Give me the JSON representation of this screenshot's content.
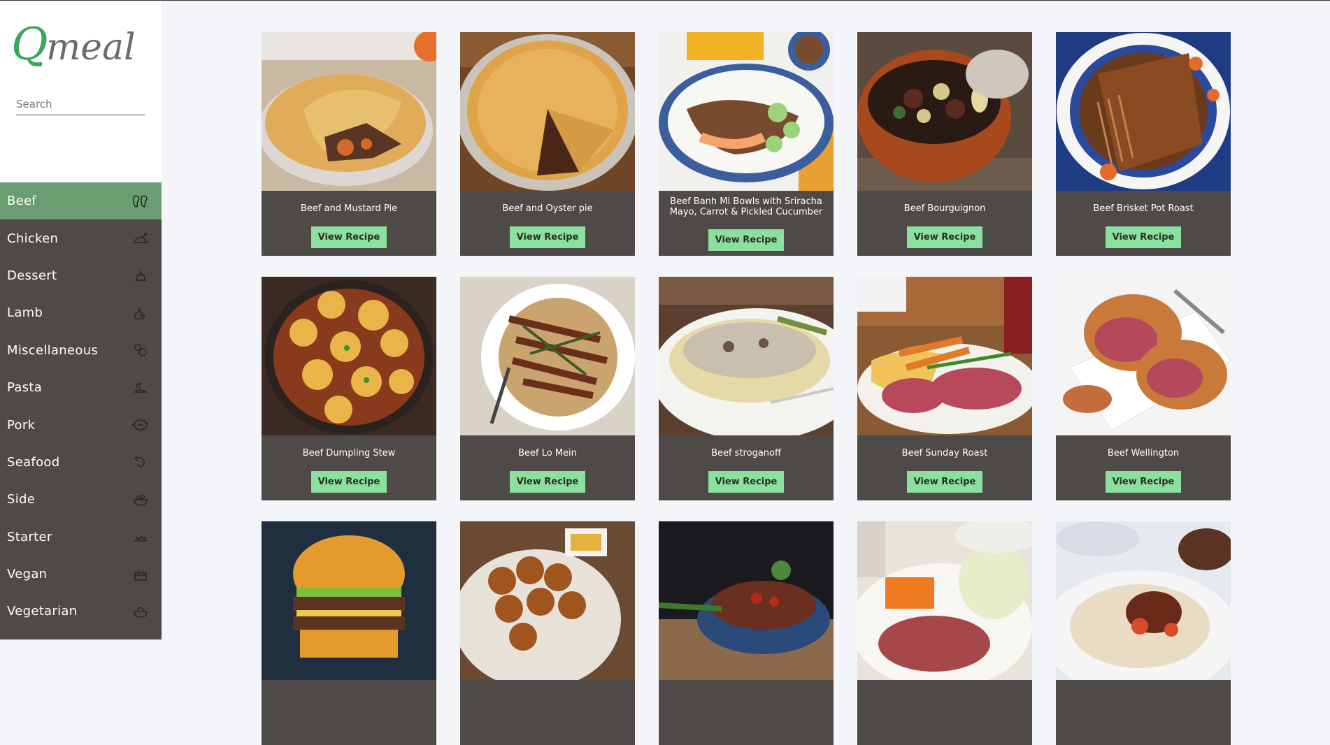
{
  "logo": {
    "text_q": "Q",
    "text_rest": "meal"
  },
  "search": {
    "placeholder": "Search",
    "value": ""
  },
  "categories": [
    {
      "label": "Beef",
      "icon": "beef-icon",
      "active": true
    },
    {
      "label": "Chicken",
      "icon": "chicken-icon",
      "active": false
    },
    {
      "label": "Dessert",
      "icon": "dessert-icon",
      "active": false
    },
    {
      "label": "Lamb",
      "icon": "lamb-icon",
      "active": false
    },
    {
      "label": "Miscellaneous",
      "icon": "miscellaneous-icon",
      "active": false
    },
    {
      "label": "Pasta",
      "icon": "pasta-icon",
      "active": false
    },
    {
      "label": "Pork",
      "icon": "pork-icon",
      "active": false
    },
    {
      "label": "Seafood",
      "icon": "seafood-icon",
      "active": false
    },
    {
      "label": "Side",
      "icon": "side-icon",
      "active": false
    },
    {
      "label": "Starter",
      "icon": "starter-icon",
      "active": false
    },
    {
      "label": "Vegan",
      "icon": "vegan-icon",
      "active": false
    },
    {
      "label": "Vegetarian",
      "icon": "vegetarian-icon",
      "active": false
    }
  ],
  "recipes": [
    {
      "title": "Beef and Mustard Pie",
      "button": "View Recipe"
    },
    {
      "title": "Beef and Oyster pie",
      "button": "View Recipe"
    },
    {
      "title": "Beef Banh Mi Bowls with Sriracha Mayo, Carrot & Pickled Cucumber",
      "button": "View Recipe"
    },
    {
      "title": "Beef Bourguignon",
      "button": "View Recipe"
    },
    {
      "title": "Beef Brisket Pot Roast",
      "button": "View Recipe"
    },
    {
      "title": "Beef Dumpling Stew",
      "button": "View Recipe"
    },
    {
      "title": "Beef Lo Mein",
      "button": "View Recipe"
    },
    {
      "title": "Beef stroganoff",
      "button": "View Recipe"
    },
    {
      "title": "Beef Sunday Roast",
      "button": "View Recipe"
    },
    {
      "title": "Beef Wellington",
      "button": "View Recipe"
    },
    {
      "title": "",
      "button": ""
    },
    {
      "title": "",
      "button": ""
    },
    {
      "title": "",
      "button": ""
    },
    {
      "title": "",
      "button": ""
    },
    {
      "title": "",
      "button": ""
    }
  ],
  "colors": {
    "sidebar_bg": "#4d4a48",
    "active_bg": "#6a9e70",
    "button_bg": "#8be09d",
    "page_bg": "#f4f5f9",
    "logo_q": "#3aa657",
    "logo_text": "#6b6b6b"
  }
}
